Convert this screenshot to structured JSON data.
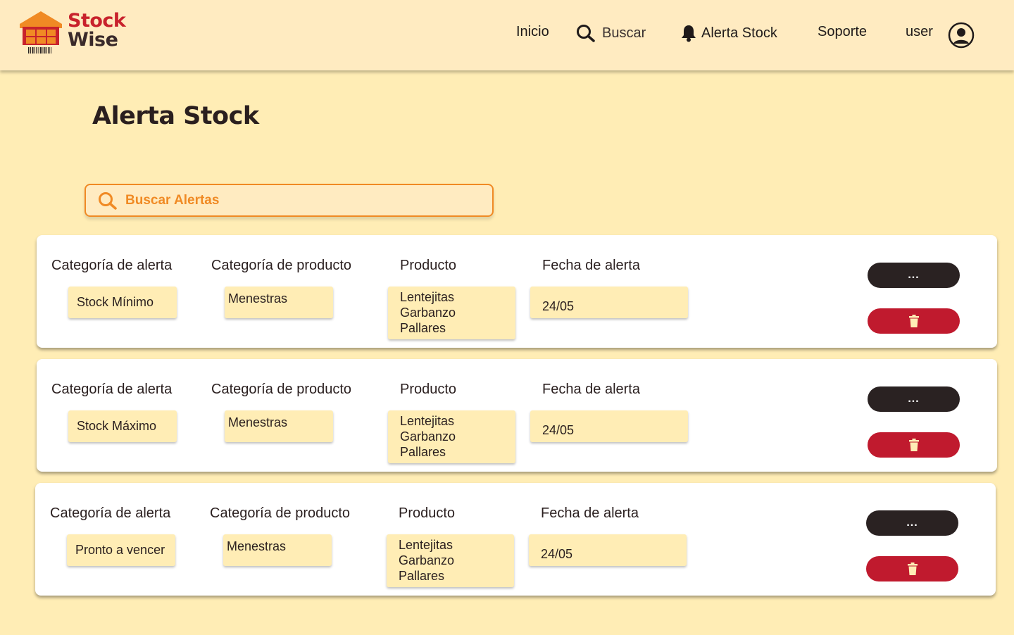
{
  "app": {
    "logo_line1": "Stock",
    "logo_line2": "Wise",
    "colors": {
      "brand_red": "#C8222C",
      "accent_orange": "#F08A24",
      "background": "#FFEDB5",
      "delete_red": "#C01A2E",
      "dark": "#2A2222"
    }
  },
  "nav": {
    "inicio": "Inicio",
    "buscar": "Buscar",
    "alerta_stock": "Alerta Stock",
    "soporte": "Soporte",
    "user": "user"
  },
  "page": {
    "title": "Alerta Stock",
    "search_placeholder": "Buscar Alertas"
  },
  "labels": {
    "categoria_alerta": "Categoría de alerta",
    "categoria_producto": "Categoría de producto",
    "producto": "Producto",
    "fecha_alerta": "Fecha de alerta",
    "more_button": "..."
  },
  "alerts": [
    {
      "categoria_alerta": "Stock Mínimo",
      "categoria_producto": "Menestras",
      "producto": "Lentejitas\nGarbanzo\nPallares",
      "fecha": "24/05"
    },
    {
      "categoria_alerta": "Stock Máximo",
      "categoria_producto": "Menestras",
      "producto": "Lentejitas\nGarbanzo\nPallares",
      "fecha": "24/05"
    },
    {
      "categoria_alerta": "Pronto a vencer",
      "categoria_producto": "Menestras",
      "producto": "Lentejitas\nGarbanzo\nPallares",
      "fecha": "24/05"
    }
  ]
}
